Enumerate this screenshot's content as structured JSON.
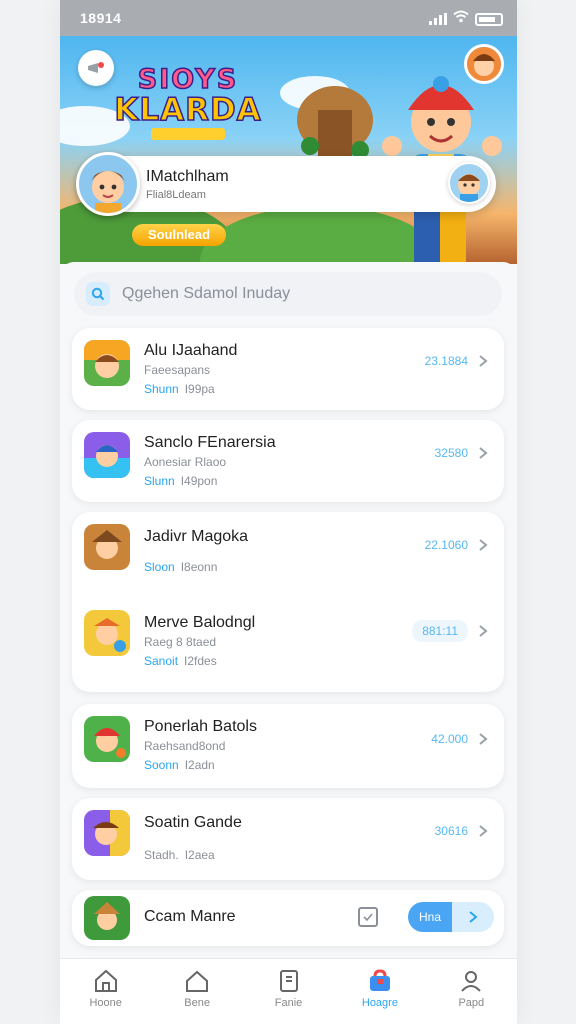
{
  "status_bar": {
    "time": "18914"
  },
  "banner": {
    "logo_line1": "SIOYS",
    "logo_line2": "KLARDA",
    "logo_ribbon": "",
    "profile_name": "IMatchlham",
    "profile_sub": "Flial8Ldeam",
    "pill_label": "Soulnlead"
  },
  "search": {
    "placeholder": "Qgehen Sdamol Inuday"
  },
  "games": [
    {
      "title": "Alu IJaahand",
      "subtitle": "Faeesapans",
      "meta_tag": "Shunn",
      "meta_text": "I99pa",
      "value": "23.1884",
      "colors": [
        "#f6a623",
        "#4fb14a"
      ]
    },
    {
      "title": "Sanclo FEnarersia",
      "subtitle": "Aonesiar Rlaoo",
      "meta_tag": "Slunn",
      "meta_text": "I49pon",
      "value": "32580",
      "colors": [
        "#8a5ee8",
        "#35c1f1"
      ]
    },
    {
      "title": "Jadivr Magoka",
      "subtitle": "",
      "meta_tag": "Sloon",
      "meta_text": "I8eonn",
      "value": "22.1060",
      "colors": [
        "#c9843a",
        "#7d4a20"
      ]
    },
    {
      "title": "Merve Balodngl",
      "subtitle": "Raeg 8 8taed",
      "meta_tag": "Sanoit",
      "meta_text": "I2fdes",
      "value": "881:11",
      "colors": [
        "#f3c93b",
        "#e96b2a"
      ]
    },
    {
      "title": "Ponerlah Batols",
      "subtitle": "Raehsand8ond",
      "meta_tag": "Soonn",
      "meta_text": "I2adn",
      "value": "42.000",
      "colors": [
        "#4fb14a",
        "#f27d2a"
      ]
    },
    {
      "title": "Soatin Gande",
      "subtitle": "",
      "meta_tag": "Stadh.",
      "meta_text": "I2aea",
      "value": "30616",
      "colors": [
        "#8a5ee8",
        "#f3c93b"
      ]
    },
    {
      "title": "Ccam Manre",
      "subtitle": "",
      "meta_tag": "",
      "meta_text": "",
      "value": "",
      "colors": [
        "#3f9a3c",
        "#c9843a"
      ],
      "button_label": "Hna"
    }
  ],
  "nav": [
    {
      "label": "Hoone",
      "icon": "home-icon"
    },
    {
      "label": "Bene",
      "icon": "house-outline-icon"
    },
    {
      "label": "Fanie",
      "icon": "document-icon"
    },
    {
      "label": "Hoagre",
      "icon": "game-bag-icon",
      "active": true
    },
    {
      "label": "Papd",
      "icon": "profile-icon"
    }
  ],
  "colors": {
    "accent": "#2ba5ee",
    "value_text": "#57b8f1",
    "button": "#4aa6f5"
  }
}
